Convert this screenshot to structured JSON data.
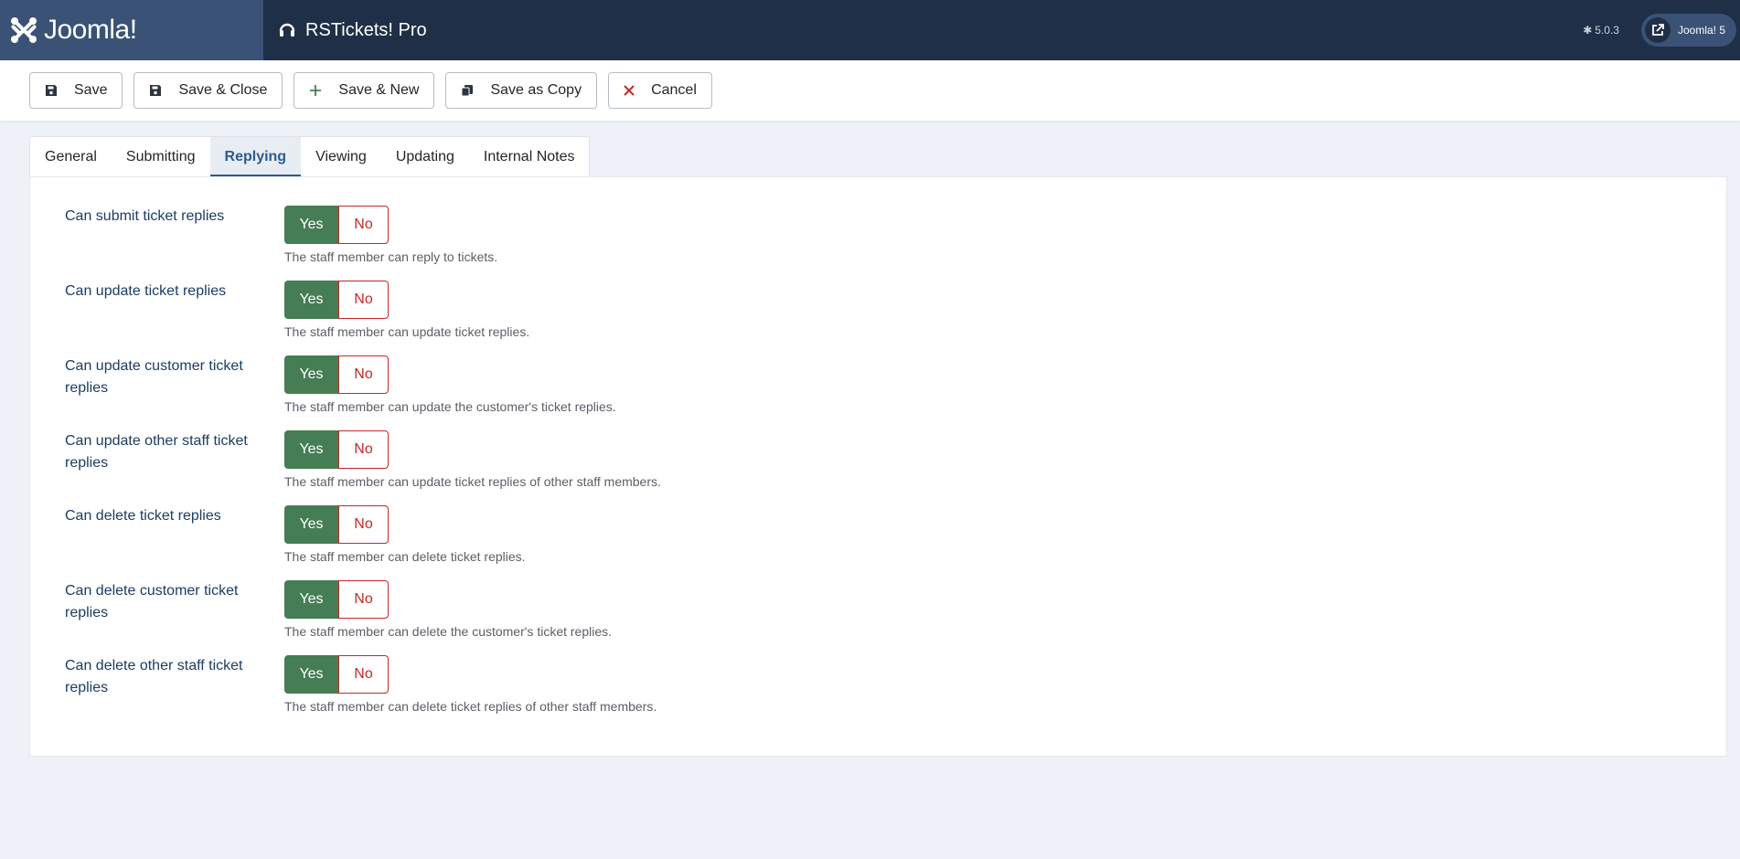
{
  "header": {
    "brand": "Joomla!",
    "app_title": "RSTickets! Pro",
    "version": "5.0.3",
    "site_button": "Joomla! 5"
  },
  "toolbar": {
    "save": "Save",
    "save_close": "Save & Close",
    "save_new": "Save & New",
    "save_copy": "Save as Copy",
    "cancel": "Cancel"
  },
  "tabs": [
    {
      "label": "General"
    },
    {
      "label": "Submitting"
    },
    {
      "label": "Replying",
      "active": true
    },
    {
      "label": "Viewing"
    },
    {
      "label": "Updating"
    },
    {
      "label": "Internal Notes"
    }
  ],
  "options": {
    "yes": "Yes",
    "no": "No"
  },
  "fields": [
    {
      "label": "Can submit ticket replies",
      "value": "Yes",
      "description": "The staff member can reply to tickets."
    },
    {
      "label": "Can update ticket replies",
      "value": "Yes",
      "description": "The staff member can update ticket replies."
    },
    {
      "label": "Can update customer ticket replies",
      "value": "Yes",
      "description": "The staff member can update the customer's ticket replies."
    },
    {
      "label": "Can update other staff ticket replies",
      "value": "Yes",
      "description": "The staff member can update ticket replies of other staff members."
    },
    {
      "label": "Can delete ticket replies",
      "value": "Yes",
      "description": "The staff member can delete ticket replies."
    },
    {
      "label": "Can delete customer ticket replies",
      "value": "Yes",
      "description": "The staff member can delete the customer's ticket replies."
    },
    {
      "label": "Can delete other staff ticket replies",
      "value": "Yes",
      "description": "The staff member can delete ticket replies of other staff members."
    }
  ],
  "colors": {
    "header_bg": "#1f2f47",
    "logo_bg": "#3a5275",
    "yes_active": "#457d54",
    "no_red": "#c52827",
    "tab_active": "#2c5b8f"
  }
}
